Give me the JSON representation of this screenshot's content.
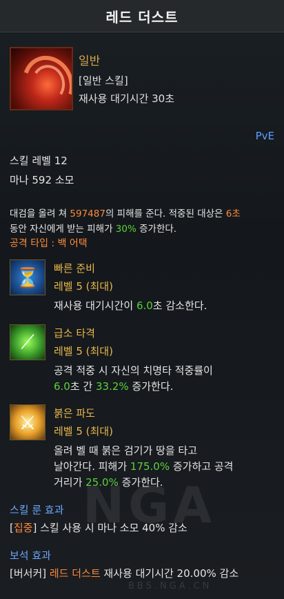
{
  "title": "레드 더스트",
  "header": {
    "grade": "일반",
    "type": "[일반 스킬]",
    "cooldown": "재사용 대기시간 30초",
    "mode": "PvE"
  },
  "stats": {
    "skill_level": "스킬 레벨 12",
    "mana": "마나 592 소모"
  },
  "description": {
    "part1": "대검을 올려 쳐 ",
    "damage": "597487",
    "part2": "의 피해를 준다. 적중된 대상은 ",
    "duration": "6초",
    "line2_part1": "동안 자신에게 받는 피해가 ",
    "percent": "30%",
    "line2_part2": " 증가한다.",
    "attack_type": "공격 타입 : 백 어택"
  },
  "tripods": [
    {
      "name": "빠른 준비",
      "level": "레벨 5 (최대)",
      "icon": "hourglass-arrow-icon",
      "desc_a": "재사용 대기시간이 ",
      "desc_v1": "6.0",
      "desc_b": "초 감소한다."
    },
    {
      "name": "급소 타격",
      "level": "레벨 5 (최대)",
      "icon": "claw-slash-icon",
      "desc_line1": "공격 적중 시 자신의 치명타 적중률이",
      "desc_v1": "6.0",
      "desc_b": "초 간 ",
      "desc_v2": "33.2%",
      "desc_c": " 증가한다."
    },
    {
      "name": "붉은 파도",
      "level": "레벨 5 (최대)",
      "icon": "sword-rays-icon",
      "desc_line1": "올려 벨 때 붉은 검기가 땅을 타고",
      "desc_a": "날아간다. 피해가 ",
      "desc_v1": "175.0%",
      "desc_b": " 증가하고 공격",
      "desc_c": "거리가 ",
      "desc_v2": "25.0%",
      "desc_d": " 증가한다."
    }
  ],
  "rune": {
    "header": "스킬 룬 효과",
    "tag": "집중",
    "text": " 스킬 사용 시 마나 소모 40% 감소"
  },
  "gem": {
    "header": "보석 효과",
    "tag": "[버서커] ",
    "skill": "레드 더스트",
    "text": " 재사용 대기시간 20.00% 감소"
  },
  "watermark": {
    "logo": "NGA",
    "url": "BBS.NGA.CN"
  },
  "colors": {
    "gold": "#e8b84a",
    "orange": "#ff8a3a",
    "green": "#5ad23a",
    "blue": "#6aa8ff"
  }
}
